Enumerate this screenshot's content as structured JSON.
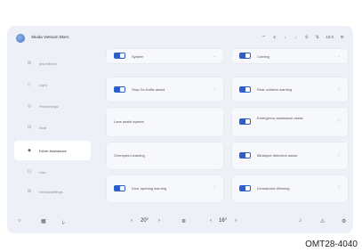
{
  "topbar": {
    "profile_name": "Skoda Vietnam Dtxro",
    "status_icons": [
      "wifi-icon",
      "bluetooth-icon",
      "signal-icon",
      "signal-icon",
      "phone-icon",
      "signal-icon",
      "settings-icon"
    ],
    "clock": "16:9"
  },
  "sidebar": {
    "items": [
      {
        "icon": "⊞",
        "label": "Ipsumbolor"
      },
      {
        "icon": "◇",
        "label": "Light"
      },
      {
        "icon": "◎",
        "label": "Parkeerings"
      },
      {
        "icon": "⊟",
        "label": "Seat"
      },
      {
        "icon": "◈",
        "label": "Driver Assistance"
      },
      {
        "icon": "⊡",
        "label": "Hub"
      },
      {
        "icon": "⊞",
        "label": "Vehiclesettings"
      }
    ]
  },
  "cards": {
    "c1": "System",
    "c2": "Coming",
    "c3": "Stop-Go traffic assist",
    "c4": "Rear collision warning",
    "c5": "Lane assist system",
    "c6": "Emergency assistance assist",
    "c7": "Overspeed warning",
    "c8": "Blindspot detection assist",
    "c9": "Door opening warning",
    "c10": "Drowsiness Warning"
  },
  "bottombar": {
    "left_temp": "20°",
    "right_temp": "16°"
  },
  "caption": "OMT28-4040"
}
